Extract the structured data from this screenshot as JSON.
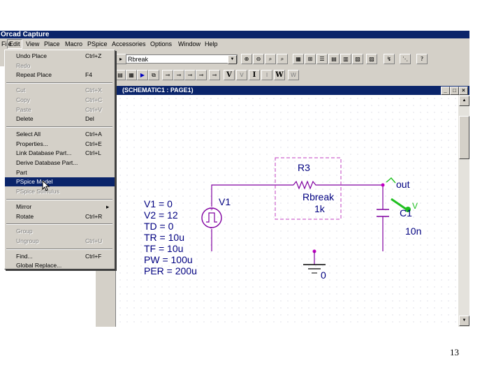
{
  "app": {
    "title": "Orcad Capture"
  },
  "menubar": [
    "File",
    "Edit",
    "View",
    "Place",
    "Macro",
    "PSpice",
    "Accessories",
    "Options",
    "Window",
    "Help"
  ],
  "toolbar": {
    "part_combo_value": "Rbreak",
    "row1_icons": [
      "zoom-in-icon",
      "zoom-out-icon",
      "zoom-area-icon",
      "zoom-all-icon",
      "annotate-icon",
      "backannotate-icon",
      "drc-icon",
      "netlist-icon",
      "crossref-icon",
      "bom-icon",
      "project-manager-icon",
      "help-icon"
    ],
    "row2_icons": [
      "new-sim-profile-icon",
      "edit-sim-profile-icon",
      "run-icon",
      "view-sim-results-icon",
      "marker-voltage-icon",
      "marker-voltage-diff-icon",
      "marker-current-icon",
      "marker-power-icon",
      "bias-v-icon",
      "bias-v-toggle-icon",
      "bias-i-icon",
      "bias-i-toggle-icon",
      "bias-w-icon",
      "bias-w-toggle-icon"
    ],
    "row2_glyphs": {
      "v": "V",
      "i": "I",
      "w": "W"
    }
  },
  "schematic_window": {
    "title": "(SCHEMATIC1 : PAGE1)"
  },
  "edit_menu": [
    {
      "label": "Undo Place",
      "shortcut": "Ctrl+Z",
      "disabled": false
    },
    {
      "label": "Redo",
      "shortcut": "",
      "disabled": true
    },
    {
      "label": "Repeat Place",
      "shortcut": "F4",
      "disabled": false
    },
    {
      "sep": true
    },
    {
      "label": "Cut",
      "shortcut": "Ctrl+X",
      "disabled": true
    },
    {
      "label": "Copy",
      "shortcut": "Ctrl+C",
      "disabled": true
    },
    {
      "label": "Paste",
      "shortcut": "Ctrl+V",
      "disabled": true
    },
    {
      "label": "Delete",
      "shortcut": "Del",
      "disabled": false
    },
    {
      "sep": true
    },
    {
      "label": "Select All",
      "shortcut": "Ctrl+A",
      "disabled": false
    },
    {
      "label": "Properties...",
      "shortcut": "Ctrl+E",
      "disabled": false
    },
    {
      "label": "Link Database Part...",
      "shortcut": "Ctrl+L",
      "disabled": false
    },
    {
      "label": "Derive Database Part...",
      "shortcut": "",
      "disabled": false
    },
    {
      "label": "Part",
      "shortcut": "",
      "disabled": false
    },
    {
      "label": "PSpice Model",
      "shortcut": "",
      "disabled": false,
      "selected": true
    },
    {
      "label": "PSpice Stimulus",
      "shortcut": "",
      "disabled": true
    },
    {
      "sep": true
    },
    {
      "label": "Mirror",
      "shortcut": "",
      "disabled": false,
      "submenu": true
    },
    {
      "label": "Rotate",
      "shortcut": "Ctrl+R",
      "disabled": false
    },
    {
      "sep": true
    },
    {
      "label": "Group",
      "shortcut": "",
      "disabled": true
    },
    {
      "label": "Ungroup",
      "shortcut": "Ctrl+U",
      "disabled": true
    },
    {
      "sep": true
    },
    {
      "label": "Find...",
      "shortcut": "Ctrl+F",
      "disabled": false
    },
    {
      "label": "Global Replace...",
      "shortcut": "",
      "disabled": false
    }
  ],
  "schematic": {
    "source_params": [
      "V1 = 0",
      "V2 = 12",
      "TD = 0",
      "TR = 10u",
      "TF = 10u",
      "PW = 100u",
      "PER = 200u"
    ],
    "source_ref": "V1",
    "resistor_ref": "R3",
    "resistor_model": "Rbreak",
    "resistor_value": "1k",
    "cap_ref": "C1",
    "cap_value": "10n",
    "net_label": "out",
    "probe_label": "V",
    "ground_label": "0",
    "colors": {
      "wire": "#8000a0",
      "part": "#8000a0",
      "text": "#0000c0",
      "box": "#c040c0",
      "probe": "#20c020",
      "label": "#0000a0"
    }
  },
  "page_number": "13"
}
